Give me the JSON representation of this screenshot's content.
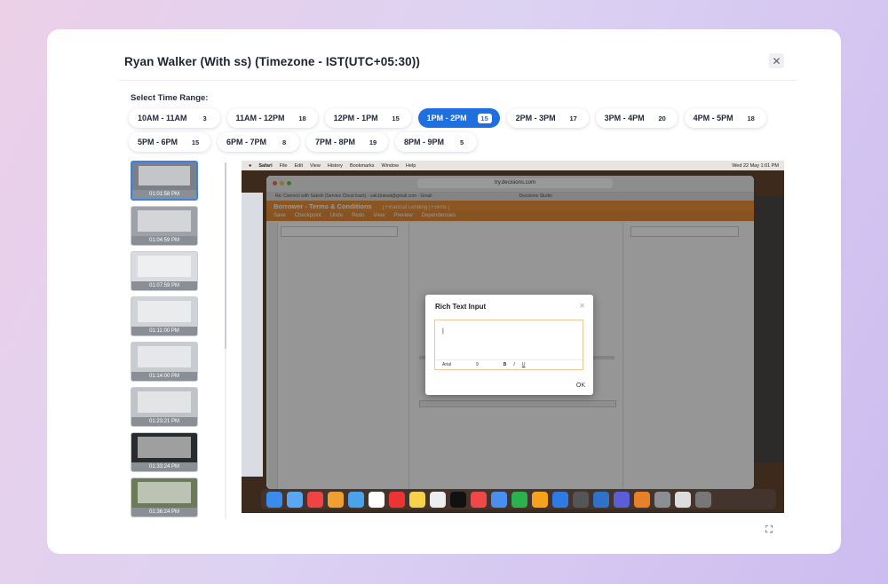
{
  "modal": {
    "title": "Ryan Walker (With ss) (Timezone - IST(UTC+05:30))",
    "close_icon": "close-icon"
  },
  "time_range": {
    "label": "Select Time Range:",
    "selected": "1PM - 2PM",
    "options": [
      {
        "label": "10AM - 11AM",
        "count": "3"
      },
      {
        "label": "11AM - 12PM",
        "count": "18"
      },
      {
        "label": "12PM - 1PM",
        "count": "15"
      },
      {
        "label": "1PM - 2PM",
        "count": "15"
      },
      {
        "label": "2PM - 3PM",
        "count": "17"
      },
      {
        "label": "3PM - 4PM",
        "count": "20"
      },
      {
        "label": "4PM - 5PM",
        "count": "18"
      },
      {
        "label": "5PM - 6PM",
        "count": "15"
      },
      {
        "label": "6PM - 7PM",
        "count": "8"
      },
      {
        "label": "7PM - 8PM",
        "count": "19"
      },
      {
        "label": "8PM - 9PM",
        "count": "5"
      }
    ]
  },
  "screenshots": {
    "selected_index": 0,
    "items": [
      {
        "time": "01:01:58 PM"
      },
      {
        "time": "01:04:59 PM"
      },
      {
        "time": "01:07:59 PM"
      },
      {
        "time": "01:11:00 PM"
      },
      {
        "time": "01:14:00 PM"
      },
      {
        "time": "01:23:21 PM"
      },
      {
        "time": "01:33:24 PM"
      },
      {
        "time": "01:36:24 PM"
      }
    ]
  },
  "viewer": {
    "menubar": {
      "items": [
        "Safari",
        "File",
        "Edit",
        "View",
        "History",
        "Bookmarks",
        "Window",
        "Help"
      ],
      "clock": "Wed 22 May  1:01 PM"
    },
    "browser": {
      "url": "try.decisions.com",
      "tabs": [
        "Re: Connect with Sakshi (Service Cloud track) - sak1trawat@gmail.com - Gmail",
        "Decisions Studio"
      ]
    },
    "app": {
      "title": "Borrower - Terms & Conditions",
      "breadcrumb": "[ Financial Lending | Forms ]",
      "toolbar": [
        "Save",
        "Checkpoint",
        "Undo",
        "Redo",
        "View",
        "Preview",
        "Dependencies"
      ]
    },
    "dialog": {
      "title": "Rich Text Input",
      "font": "Arial",
      "size": "9",
      "ok_label": "OK"
    }
  },
  "colors": {
    "accent": "#1f6fe0",
    "app_header": "#e8903a"
  },
  "fullscreen_icon": "expand-icon"
}
